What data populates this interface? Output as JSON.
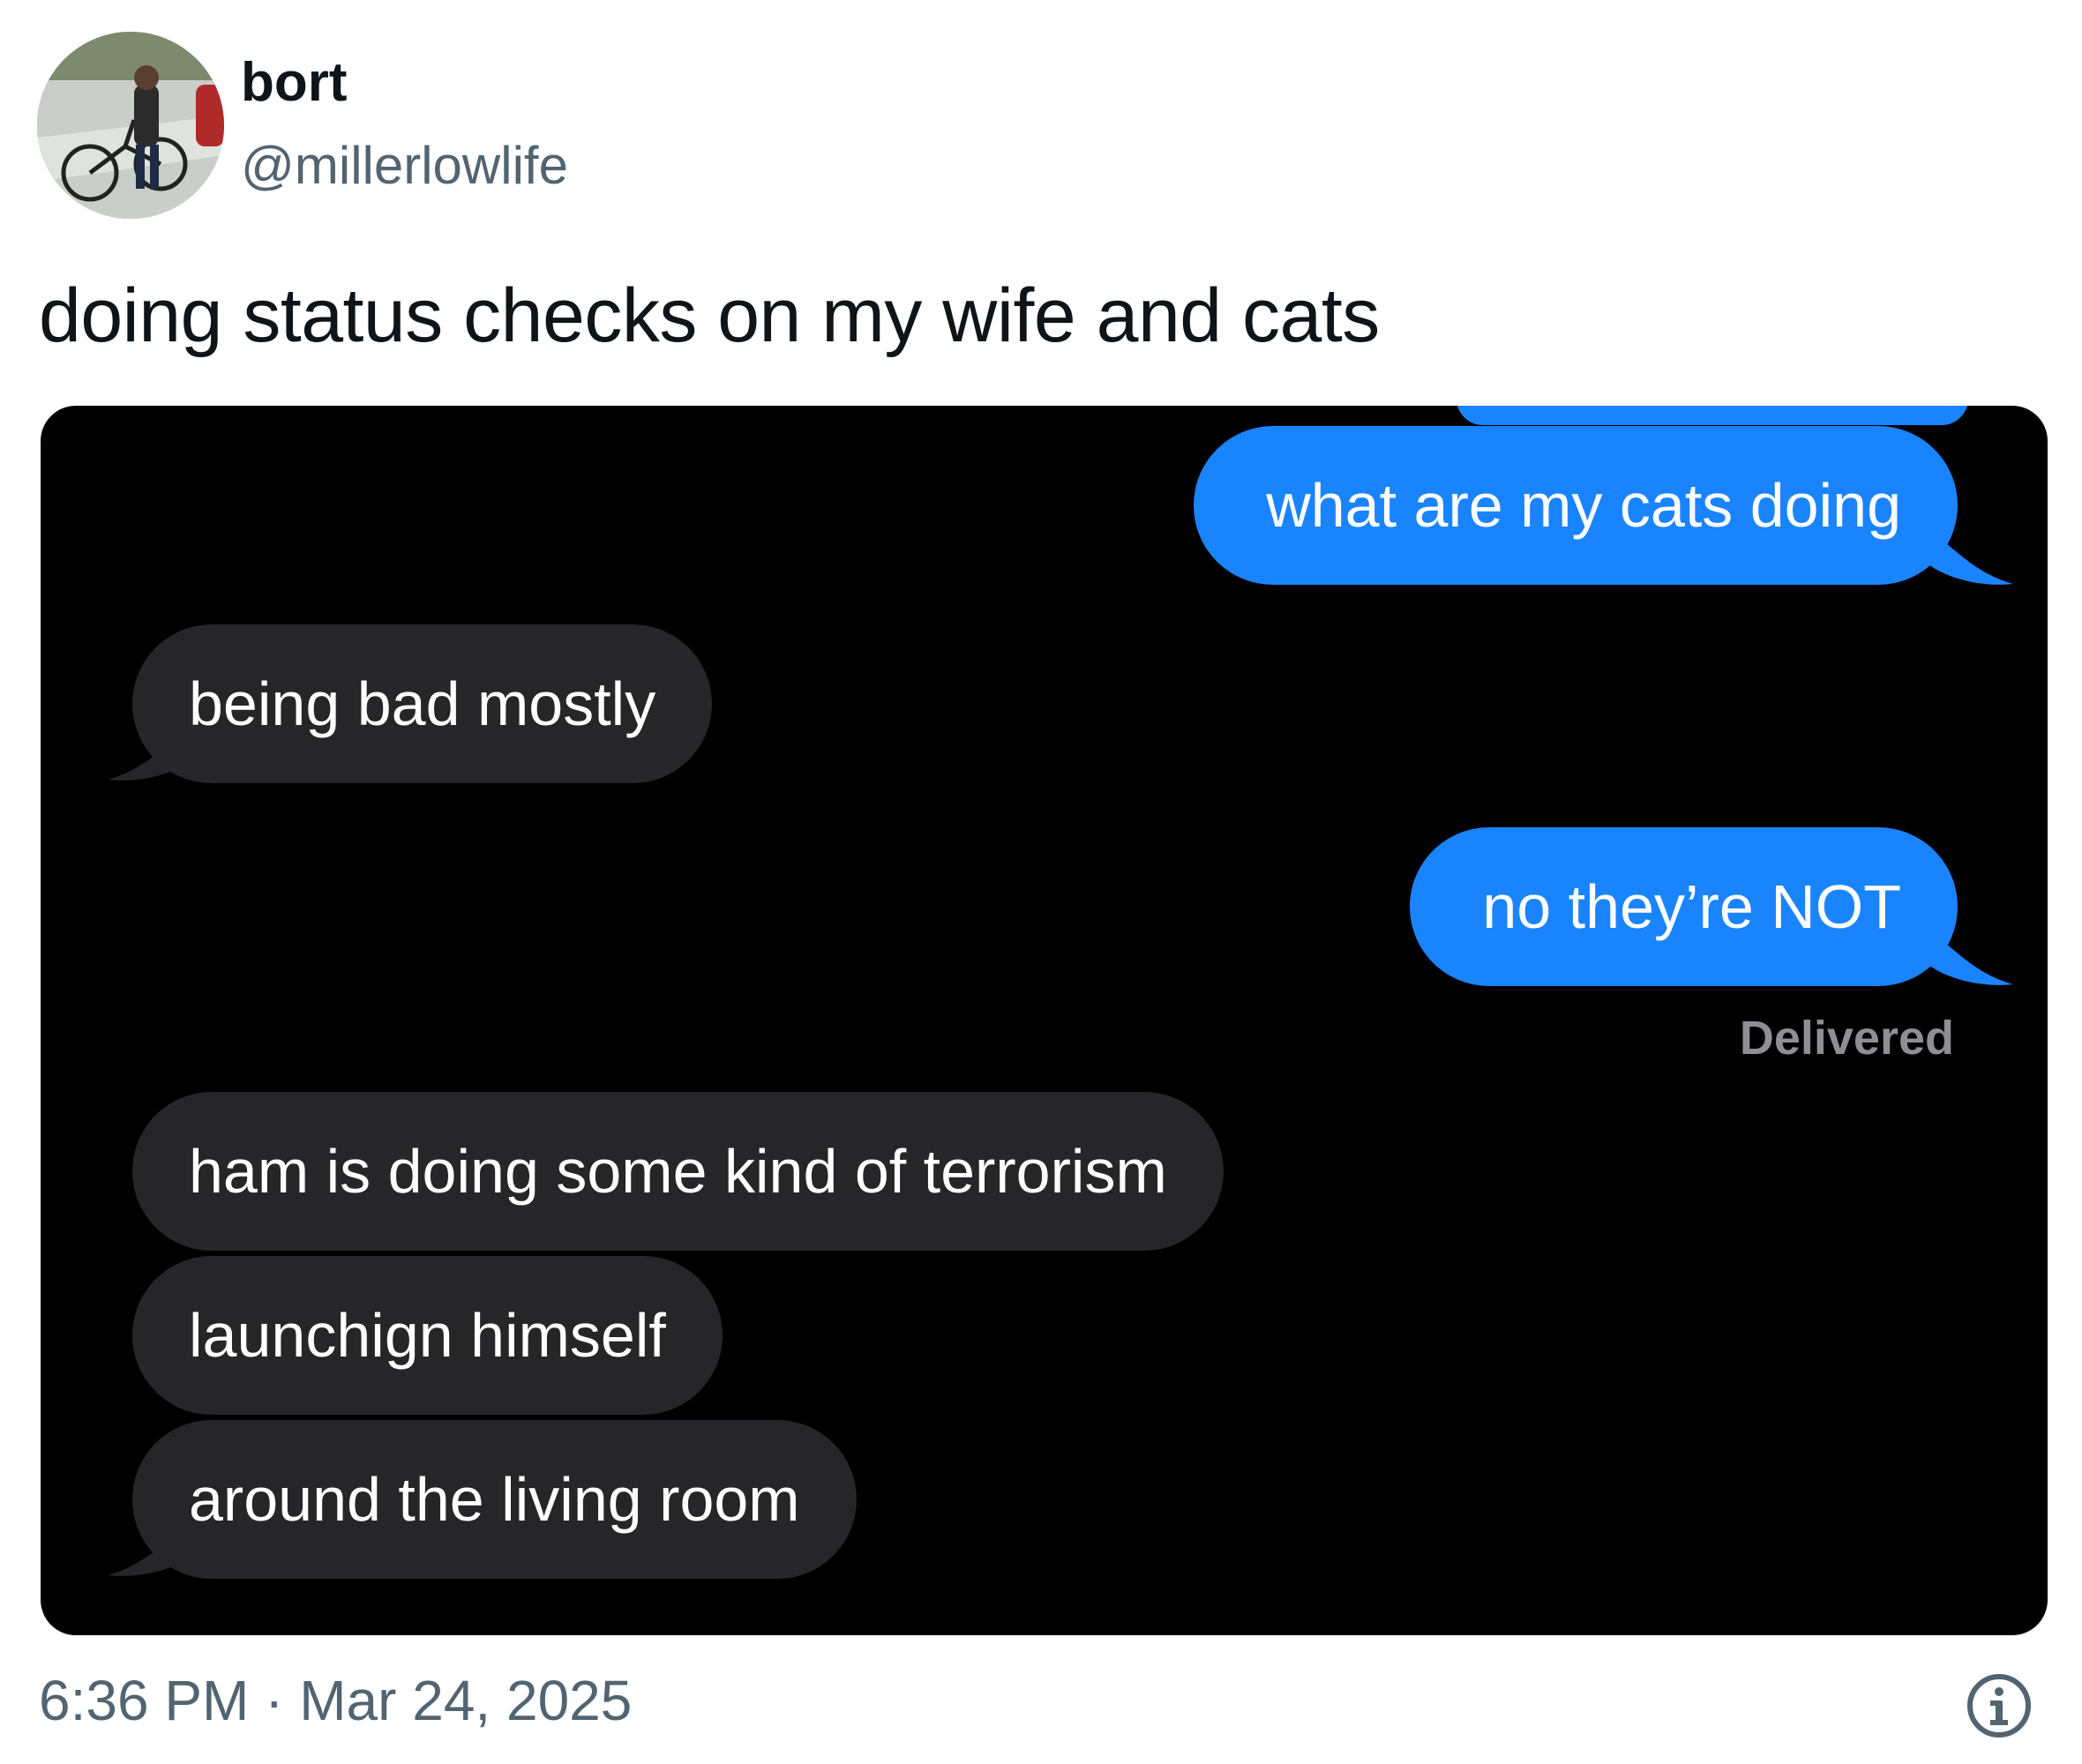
{
  "author": {
    "display_name": "bort",
    "handle": "@millerlowlife"
  },
  "tweet": {
    "text": "doing status checks on my wife and cats",
    "timestamp": "6:36 PM · Mar 24, 2025"
  },
  "conversation": {
    "messages": [
      {
        "direction": "outgoing",
        "text": "what are my cats doing"
      },
      {
        "direction": "incoming",
        "text": "being bad mostly"
      },
      {
        "direction": "outgoing",
        "text": "no they’re NOT"
      },
      {
        "direction": "incoming",
        "text": "ham is doing some kind of terrorism"
      },
      {
        "direction": "incoming",
        "text": "launchign himself"
      },
      {
        "direction": "incoming",
        "text": "around the living room"
      }
    ],
    "receipt": "Delivered"
  },
  "colors": {
    "outgoing_bubble": "#1a84ff",
    "incoming_bubble": "#262628",
    "media_background": "#000000",
    "secondary_text": "#536471"
  },
  "icons": {
    "info": "info-icon"
  }
}
